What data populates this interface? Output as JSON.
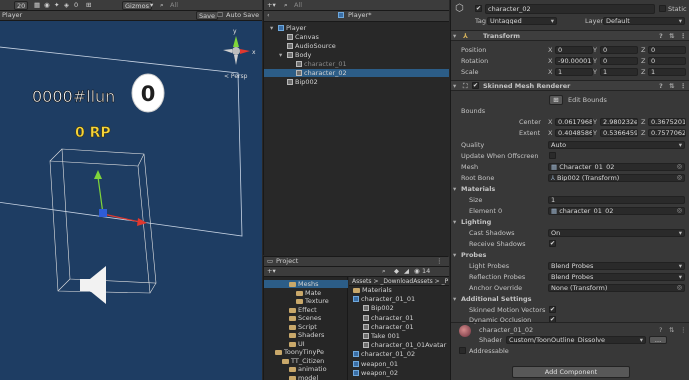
{
  "scene": {
    "toolbar": {
      "zoom_value": "20",
      "gizmo_count": "0",
      "gizmos_label": "Gizmos",
      "search_placeholder": "All"
    },
    "tab": {
      "title": "Player",
      "save_label": "Save",
      "auto_save_label": "Auto Save"
    },
    "persp_label": "< Persp",
    "axis_y": "y",
    "axis_x": "x",
    "name_text": "0000#llun",
    "rank_badge": "0",
    "rp_text": "0 RP"
  },
  "hierarchy": {
    "search_placeholder": "All",
    "header_title": "Player*",
    "items": [
      {
        "label": "Player",
        "indent": 0,
        "expanded": true,
        "icon": "prefab-icon"
      },
      {
        "label": "Canvas",
        "indent": 1,
        "icon": "cube-icon"
      },
      {
        "label": "AudioSource",
        "indent": 1,
        "icon": "cube-icon"
      },
      {
        "label": "Body",
        "indent": 1,
        "expanded": true,
        "icon": "cube-icon"
      },
      {
        "label": "character_01",
        "indent": 2,
        "icon": "cube-icon",
        "disabled": true
      },
      {
        "label": "character_02",
        "indent": 2,
        "icon": "cube-icon",
        "selected": true
      },
      {
        "label": "Bip002",
        "indent": 1,
        "icon": "cube-icon"
      }
    ]
  },
  "project": {
    "tab_title": "Project",
    "hidden_count": "14",
    "tree": [
      {
        "label": "Meshs",
        "indent": 3,
        "selected": true
      },
      {
        "label": "Mate",
        "indent": 4
      },
      {
        "label": "Texture",
        "indent": 4
      },
      {
        "label": "Effect",
        "indent": 3
      },
      {
        "label": "Scenes",
        "indent": 3
      },
      {
        "label": "Script",
        "indent": 3
      },
      {
        "label": "Shaders",
        "indent": 3
      },
      {
        "label": "UI",
        "indent": 3
      },
      {
        "label": "ToonyTinyPe",
        "indent": 1
      },
      {
        "label": "TT_Citizen",
        "indent": 2
      },
      {
        "label": "animatio",
        "indent": 3
      },
      {
        "label": "model",
        "indent": 3
      }
    ],
    "breadcrumb": [
      "Assets",
      "_DownloadAssets",
      "_P"
    ],
    "files": [
      {
        "label": "Materials",
        "indent": 0,
        "kind": "folder"
      },
      {
        "label": "character_01_01",
        "indent": 0,
        "kind": "model"
      },
      {
        "label": "Bip002",
        "indent": 1,
        "kind": "bone"
      },
      {
        "label": "character_01",
        "indent": 1,
        "kind": "mesh"
      },
      {
        "label": "character_01",
        "indent": 1,
        "kind": "grid"
      },
      {
        "label": "Take 001",
        "indent": 1,
        "kind": "anim"
      },
      {
        "label": "character_01_01Avatar",
        "indent": 1,
        "kind": "avatar"
      },
      {
        "label": "character_01_02",
        "indent": 0,
        "kind": "model"
      },
      {
        "label": "weapon_01",
        "indent": 0,
        "kind": "model"
      },
      {
        "label": "weapon_02",
        "indent": 0,
        "kind": "model"
      }
    ]
  },
  "inspector": {
    "object_name": "character_02",
    "static_label": "Static",
    "tag_label": "Tag",
    "tag_value": "Untagged",
    "layer_label": "Layer",
    "layer_value": "Default",
    "transform": {
      "title": "Transform",
      "position_label": "Position",
      "rotation_label": "Rotation",
      "scale_label": "Scale",
      "position": {
        "x": "0",
        "y": "0",
        "z": "0"
      },
      "rotation": {
        "x": "-90.00001",
        "y": "0",
        "z": "0"
      },
      "scale": {
        "x": "1",
        "y": "1",
        "z": "1"
      }
    },
    "skinned": {
      "title": "Skinned Mesh Renderer",
      "edit_bounds_label": "Edit Bounds",
      "bounds_label": "Bounds",
      "center_label": "Center",
      "extent_label": "Extent",
      "center": {
        "x": "0.0617968",
        "y": "2.980232e-",
        "z": "0.3675201"
      },
      "extent": {
        "x": "0.4048586",
        "y": "0.5366459",
        "z": "0.7577062"
      },
      "quality_label": "Quality",
      "quality_value": "Auto",
      "update_offscreen_label": "Update When Offscreen",
      "update_offscreen": false,
      "mesh_label": "Mesh",
      "mesh_value": "Character_01_02",
      "root_bone_label": "Root Bone",
      "root_bone_value": "Bip002 (Transform)",
      "materials_label": "Materials",
      "size_label": "Size",
      "size_value": "1",
      "element0_label": "Element 0",
      "element0_value": "character_01_02",
      "lighting_label": "Lighting",
      "cast_shadows_label": "Cast Shadows",
      "cast_shadows_value": "On",
      "receive_shadows_label": "Receive Shadows",
      "receive_shadows": true,
      "probes_label": "Probes",
      "light_probes_label": "Light Probes",
      "light_probes_value": "Blend Probes",
      "reflection_probes_label": "Reflection Probes",
      "reflection_probes_value": "Blend Probes",
      "anchor_override_label": "Anchor Override",
      "anchor_override_value": "None (Transform)",
      "additional_label": "Additional Settings",
      "skinned_motion_label": "Skinned Motion Vectors",
      "skinned_motion": true,
      "dynamic_occlusion_label": "Dynamic Occlusion",
      "dynamic_occlusion": true
    },
    "material": {
      "name": "character_01_02",
      "shader_label": "Shader",
      "shader_value": "Custom/ToonOutline_Dissolve"
    },
    "addressable_label": "Addressable",
    "add_component_label": "Add Component",
    "axes": {
      "x": "X",
      "y": "Y",
      "z": "Z"
    },
    "checkmark": "✔"
  }
}
